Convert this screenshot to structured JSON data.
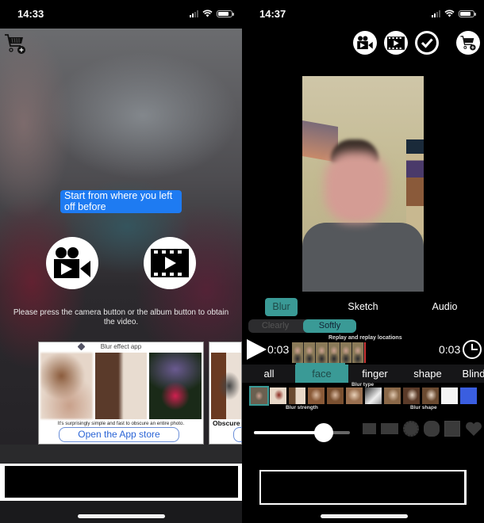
{
  "left": {
    "status": {
      "time": "14:33",
      "battery_level": 0.7,
      "signal_bars": 2
    },
    "cart_icon": "cart-plus-icon",
    "tooltip": "Start from where you left off before",
    "camera_button_icon": "video-camera-icon",
    "album_button_icon": "film-play-icon",
    "hint": "Please press the camera button or the album button to obtain the video.",
    "ads": [
      {
        "title": "Blur effect app",
        "description": "It's surprisingly simple and fast to obscure an entire photo.",
        "button": "Open the App store"
      },
      {
        "description": "Obscure"
      }
    ]
  },
  "right": {
    "status": {
      "time": "14:37",
      "battery_level": 0.7,
      "signal_bars": 2
    },
    "toolbar": [
      {
        "icon": "video-camera-icon"
      },
      {
        "icon": "film-play-icon"
      },
      {
        "icon": "checkmark-icon"
      },
      {
        "icon": "cart-plus-icon"
      }
    ],
    "mode_tabs": [
      {
        "label": "Blur",
        "active": true
      },
      {
        "label": "Sketch",
        "active": false
      },
      {
        "label": "Audio",
        "active": false
      }
    ],
    "segment": {
      "options": [
        "Clearly",
        "Softly"
      ],
      "selected": "Softly"
    },
    "timeline": {
      "label": "Replay and replay locations",
      "start_time": "0:03",
      "end_time": "0:03"
    },
    "categories": [
      {
        "label": "all",
        "active": false
      },
      {
        "label": "face",
        "active": true
      },
      {
        "label": "finger",
        "active": false
      },
      {
        "label": "shape",
        "active": false
      },
      {
        "label": "Blind",
        "active": false
      }
    ],
    "labels": {
      "blur_type": "Blur type",
      "blur_strength": "Blur strength",
      "blur_shape": "Blur shape"
    },
    "blur_strength_value": 0.73,
    "shapes": [
      "rectangle",
      "rounded-rectangle",
      "spiky-circle",
      "cloud",
      "note",
      "heart"
    ],
    "accent_color": "#3a9a96"
  }
}
